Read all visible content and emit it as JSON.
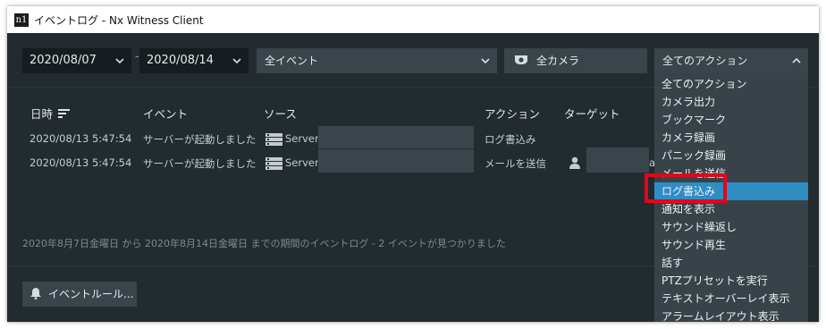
{
  "window": {
    "app_icon_text": "n1",
    "title": "イベントログ - Nx Witness Client"
  },
  "filters": {
    "date_from": "2020/08/07",
    "date_to": "2020/08/14",
    "date_separator": "-",
    "event_type": "全イベント",
    "camera": "全カメラ",
    "action": "全てのアクション"
  },
  "table": {
    "headers": [
      "日時",
      "イベント",
      "ソース",
      "アクション",
      "ターゲット"
    ],
    "rows": [
      {
        "datetime": "2020/08/13 5:47:54",
        "event": "サーバーが起動しました",
        "source": "Server",
        "action": "ログ書込み",
        "target": ""
      },
      {
        "datetime": "2020/08/13 5:47:54",
        "event": "サーバーが起動しました",
        "source": "Server",
        "action": "メールを送信",
        "target": "a"
      }
    ]
  },
  "summary": "2020年8月7日金曜日 から 2020年8月14日金曜日 までの期間のイベントログ - 2 イベントが見つかりました",
  "event_rules_button": "イベントルール...",
  "action_dropdown": {
    "items": [
      "全てのアクション",
      "カメラ出力",
      "ブックマーク",
      "カメラ録画",
      "パニック録画",
      "メールを送信",
      "ログ書込み",
      "通知を表示",
      "サウンド繰返し",
      "サウンド再生",
      "話す",
      "PTZプリセットを実行",
      "テキストオーバーレイ表示",
      "アラームレイアウト表示"
    ],
    "selected": "ログ書込み"
  },
  "colors": {
    "background": "#222b30",
    "highlight": "#2f8dc4",
    "annotation": "#e3061b"
  }
}
